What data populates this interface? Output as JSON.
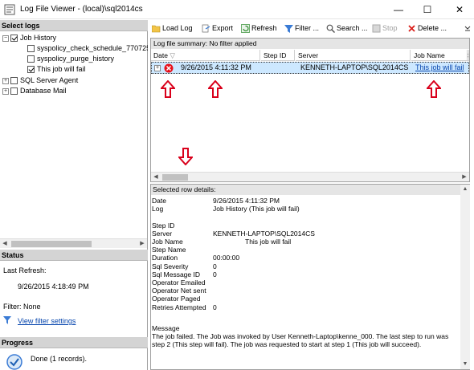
{
  "window": {
    "title": "Log File Viewer - (local)\\sql2014cs",
    "minimize": "—",
    "maximize": "☐",
    "close": "✕"
  },
  "left": {
    "select_logs_header": "Select logs",
    "tree": [
      {
        "label": "Job History",
        "expander": "−",
        "checked": true
      },
      {
        "label": "syspolicy_check_schedule_7707258",
        "checked": false
      },
      {
        "label": "syspolicy_purge_history",
        "checked": false
      },
      {
        "label": "This job will fail",
        "checked": true
      },
      {
        "label": "SQL Server Agent",
        "expander": "+",
        "checked": false
      },
      {
        "label": "Database Mail",
        "expander": "+",
        "checked": false
      }
    ],
    "status_header": "Status",
    "last_refresh_label": "Last Refresh:",
    "last_refresh_value": "9/26/2015 4:18:49 PM",
    "filter_label": "Filter: None",
    "view_filter_link": "View filter settings",
    "progress_header": "Progress",
    "progress_text": "Done (1 records)."
  },
  "toolbar": {
    "load_log": "Load Log",
    "export": "Export",
    "refresh": "Refresh",
    "filter": "Filter ...",
    "search": "Search ...",
    "stop": "Stop",
    "delete": "Delete ..."
  },
  "grid": {
    "summary": "Log file summary: No filter applied",
    "columns": [
      "Date",
      "Step ID",
      "Server",
      "Job Name",
      "S"
    ],
    "row": {
      "date": "9/26/2015 4:11:32 PM",
      "step_id": "",
      "server": "KENNETH-LAPTOP\\SQL2014CS",
      "job_name": "This job will fail"
    }
  },
  "details": {
    "header": "Selected row details:",
    "fields": [
      {
        "label": "Date",
        "value": "9/26/2015 4:11:32 PM"
      },
      {
        "label": "Log",
        "value": "Job History (This job will fail)"
      },
      {
        "label": "",
        "value": ""
      },
      {
        "label": "Step ID",
        "value": ""
      },
      {
        "label": "Server",
        "value": "KENNETH-LAPTOP\\SQL2014CS"
      },
      {
        "label": "Job Name",
        "value": "This job will fail"
      },
      {
        "label": "Step Name",
        "value": ""
      },
      {
        "label": "Duration",
        "value": "00:00:00"
      },
      {
        "label": "Sql Severity",
        "value": "0"
      },
      {
        "label": "Sql Message ID",
        "value": "0"
      },
      {
        "label": "Operator Emailed",
        "value": ""
      },
      {
        "label": "Operator Net sent",
        "value": ""
      },
      {
        "label": "Operator Paged",
        "value": ""
      },
      {
        "label": "Retries Attempted",
        "value": "0"
      }
    ],
    "message_label": "Message",
    "message_line1": "The job failed.  The Job was invoked by User Kenneth-Laptop\\kenne_000.  The last step to run was",
    "message_line2": "step 2 (This step will fail).  The job was requested to start at step 1 (This job will succeed)."
  },
  "colors": {
    "selection": "#cde8ff",
    "annotation_arrow": "#d9001b",
    "error_icon": "#e8111b",
    "link": "#0645ad"
  }
}
